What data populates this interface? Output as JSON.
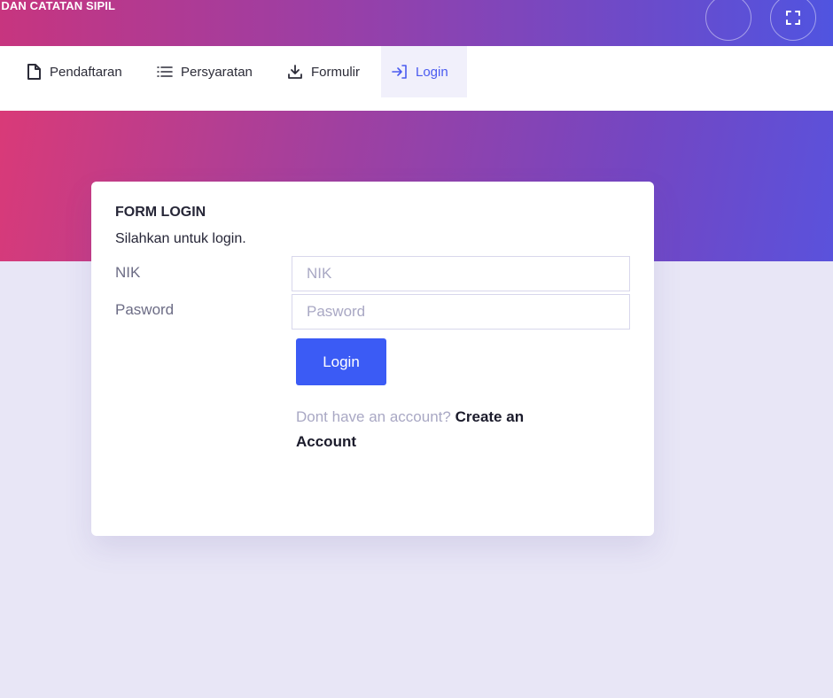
{
  "header": {
    "brand": "I DAN CATATAN SIPIL",
    "user_button_icon": "avatar-icon",
    "fullscreen_button_icon": "fullscreen-icon"
  },
  "nav": {
    "items": [
      {
        "label": "Pendaftaran",
        "icon": "document-icon",
        "active": false
      },
      {
        "label": "Persyaratan",
        "icon": "list-icon",
        "active": false
      },
      {
        "label": "Formulir",
        "icon": "download-icon",
        "active": false
      },
      {
        "label": "Login",
        "icon": "login-icon",
        "active": true
      }
    ]
  },
  "login_form": {
    "title": "FORM LOGIN",
    "subtitle": "Silahkan untuk login.",
    "nik_label": "NIK",
    "nik_placeholder": "NIK",
    "nik_value": "",
    "password_label": "Pasword",
    "password_placeholder": "Pasword",
    "password_value": "",
    "submit_label": "Login",
    "signup_prompt": "Dont have an account?",
    "signup_link": "Create an Account"
  },
  "colors": {
    "accent": "#3b5bf5",
    "gradient_start": "#d93a78",
    "gradient_end": "#5054e0",
    "page_background": "#e8e6f6"
  }
}
